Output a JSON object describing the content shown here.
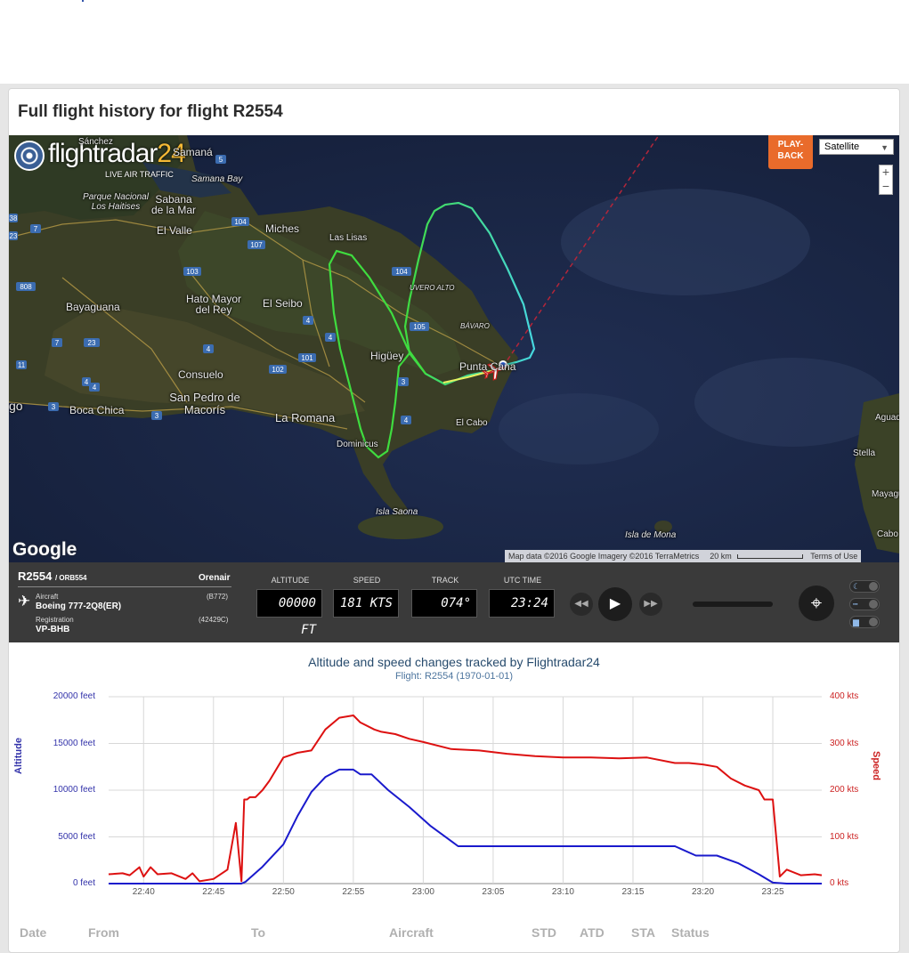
{
  "page": {
    "title": "Full flight history for flight R2554"
  },
  "map": {
    "brand": "flightradar",
    "brand_number": "24",
    "tagline": "LIVE AIR TRAFFIC",
    "playback_label": "PLAY-BACK",
    "map_type": "Satellite",
    "zoom_in": "+",
    "zoom_out": "−",
    "google": "Google",
    "attribution": "Map data ©2016 Google Imagery ©2016 TerraMetrics",
    "scale": "20 km",
    "terms": "Terms of Use",
    "places": [
      {
        "text": "Sánchez"
      },
      {
        "text": "Samaná"
      },
      {
        "text": "Samana Bay"
      },
      {
        "text": "Parque Nacional Los Haitises"
      },
      {
        "text": "Sabana de la Mar"
      },
      {
        "text": "El Valle"
      },
      {
        "text": "Miches"
      },
      {
        "text": "Las Lisas"
      },
      {
        "text": "Uvero Alto"
      },
      {
        "text": "Bayaguana"
      },
      {
        "text": "Hato Mayor del Rey"
      },
      {
        "text": "El Seibo"
      },
      {
        "text": "Higüey"
      },
      {
        "text": "Bávaro"
      },
      {
        "text": "Punta Cana"
      },
      {
        "text": "Consuelo"
      },
      {
        "text": "San Pedro de Macorís"
      },
      {
        "text": "Boca Chica"
      },
      {
        "text": "La Romana"
      },
      {
        "text": "El Cabo"
      },
      {
        "text": "Dominicus"
      },
      {
        "text": "Isla Saona"
      },
      {
        "text": "Isla de Mona"
      },
      {
        "text": "Aguadilla"
      },
      {
        "text": "Stella"
      },
      {
        "text": "Mayagüez"
      },
      {
        "text": "Cabo Rojo"
      },
      {
        "text": "go"
      }
    ]
  },
  "flight": {
    "callsign": "R2554",
    "callsign_sub": "/ ORB554",
    "airline": "Orenair",
    "aircraft_label": "Aircraft",
    "aircraft_code": "(B772)",
    "aircraft": "Boeing 777-2Q8(ER)",
    "registration_label": "Registration",
    "registration_code": "(42429C)",
    "registration": "VP-BHB"
  },
  "gauges": {
    "altitude_label": "ALTITUDE",
    "altitude": "00000 FT",
    "speed_label": "SPEED",
    "speed": "181 KTS",
    "track_label": "TRACK",
    "track": "074°",
    "utc_label": "UTC TIME",
    "utc": "23:24"
  },
  "chart_data": {
    "type": "line",
    "title": "Altitude and speed changes tracked by Flightradar24",
    "subtitle": "Flight: R2554 (1970-01-01)",
    "ylabel": "Altitude",
    "y2label": "Speed",
    "ylim": [
      0,
      20000
    ],
    "y2lim": [
      0,
      400
    ],
    "yticks": [
      "0 feet",
      "5000 feet",
      "10000 feet",
      "15000 feet",
      "20000 feet"
    ],
    "y2ticks": [
      "0 kts",
      "100 kts",
      "200 kts",
      "300 kts",
      "400 kts"
    ],
    "xticks": [
      "22:40",
      "22:45",
      "22:50",
      "22:55",
      "23:00",
      "23:05",
      "23:10",
      "23:15",
      "23:20",
      "23:25"
    ],
    "xrange_min": [
      37.5,
      88.5
    ],
    "grid": true,
    "series": [
      {
        "name": "Altitude",
        "color": "#1a1acc",
        "axis": "left",
        "x": [
          37.5,
          47.0,
          47.3,
          48.5,
          50.0,
          51.0,
          52.0,
          53.0,
          54.0,
          55.0,
          55.5,
          56.3,
          57.5,
          59.0,
          60.5,
          61.5,
          62.5,
          65.0,
          70.0,
          75.0,
          78.0,
          79.5,
          81.0,
          82.5,
          84.0,
          85.0,
          86.0,
          88.5
        ],
        "values": [
          0,
          0,
          200,
          1800,
          4200,
          7200,
          9800,
          11400,
          12200,
          12200,
          11700,
          11700,
          10000,
          8200,
          6200,
          5100,
          4000,
          4000,
          4000,
          4000,
          4000,
          3000,
          3000,
          2200,
          1000,
          100,
          0,
          0
        ]
      },
      {
        "name": "Speed",
        "color": "#dd1111",
        "axis": "right",
        "x": [
          37.5,
          38.5,
          39.0,
          39.7,
          40.0,
          40.5,
          41.0,
          42.0,
          43.0,
          43.5,
          44.0,
          45.0,
          46.0,
          46.6,
          47.0,
          47.2,
          47.4,
          47.6,
          48.0,
          48.5,
          49.0,
          50.0,
          51.0,
          52.0,
          53.0,
          54.0,
          55.0,
          55.5,
          56.5,
          57.0,
          58.0,
          59.0,
          60.0,
          62.0,
          64.0,
          66.0,
          68.0,
          70.0,
          72.0,
          74.0,
          76.0,
          78.0,
          79.0,
          80.0,
          81.0,
          82.0,
          83.0,
          84.0,
          84.4,
          85.0,
          85.5,
          86.0,
          87.0,
          88.0,
          88.5
        ],
        "values": [
          20,
          22,
          18,
          35,
          15,
          35,
          20,
          22,
          10,
          22,
          5,
          10,
          30,
          130,
          5,
          180,
          180,
          185,
          185,
          200,
          220,
          270,
          280,
          285,
          330,
          355,
          360,
          345,
          330,
          325,
          320,
          310,
          303,
          288,
          285,
          278,
          273,
          270,
          270,
          268,
          270,
          258,
          258,
          255,
          250,
          225,
          210,
          200,
          180,
          180,
          15,
          30,
          18,
          20,
          18
        ]
      }
    ]
  },
  "table": {
    "headers": [
      "Date",
      "From",
      "To",
      "Aircraft",
      "STD",
      "ATD",
      "STA",
      "Status"
    ]
  }
}
